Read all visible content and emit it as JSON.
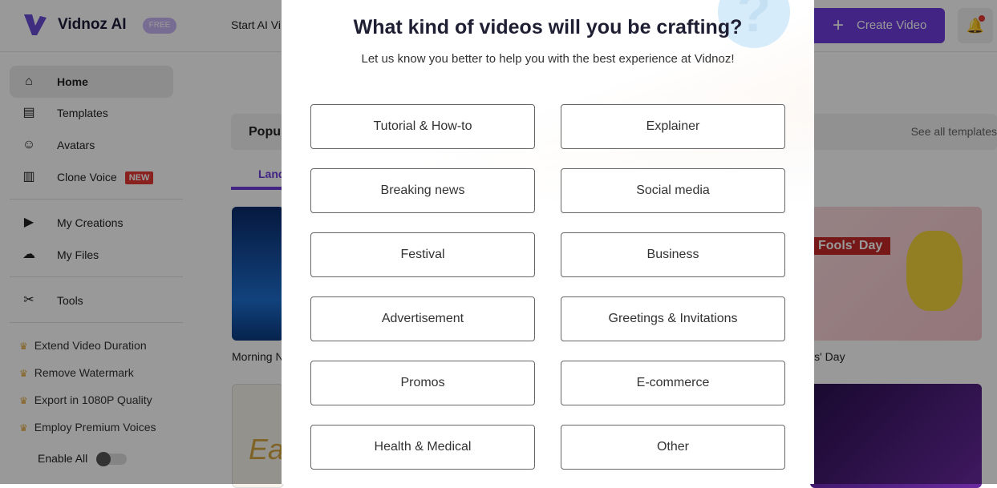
{
  "header": {
    "brand": "Vidnoz AI",
    "plan_badge": "FREE",
    "nav_item": "Start AI Vi",
    "create_label": "Create Video"
  },
  "sidebar": {
    "items": [
      {
        "label": "Home",
        "icon": "home-icon"
      },
      {
        "label": "Templates",
        "icon": "templates-icon"
      },
      {
        "label": "Avatars",
        "icon": "avatar-icon"
      },
      {
        "label": "Clone Voice",
        "icon": "voice-icon",
        "badge": "NEW"
      },
      {
        "label": "My Creations",
        "icon": "play-icon"
      },
      {
        "label": "My Files",
        "icon": "upload-icon"
      },
      {
        "label": "Tools",
        "icon": "tools-icon"
      }
    ],
    "premium": [
      "Extend Video Duration",
      "Remove Watermark",
      "Export in 1080P Quality",
      "Employ Premium Voices"
    ],
    "enable_all": "Enable All",
    "enable_all_on": false
  },
  "main": {
    "section_title": "Popul",
    "see_all": "See all templates",
    "tab": "Land",
    "cards": [
      {
        "caption": "Morning N"
      },
      {
        "caption": "ls' Day",
        "thumb_text": "Fools' Day"
      }
    ],
    "thumb2_text": "Ea"
  },
  "modal": {
    "title": "What kind of videos will you be crafting?",
    "subtitle": "Let us know you better to help you with the best experience at Vidnoz!",
    "options": [
      "Tutorial & How-to",
      "Explainer",
      "Breaking news",
      "Social media",
      "Festival",
      "Business",
      "Advertisement",
      "Greetings & Invitations",
      "Promos",
      "E-commerce",
      "Health & Medical",
      "Other"
    ]
  },
  "colors": {
    "accent": "#6d3ddc",
    "new_badge": "#e53935",
    "crown": "#e0a63a"
  }
}
